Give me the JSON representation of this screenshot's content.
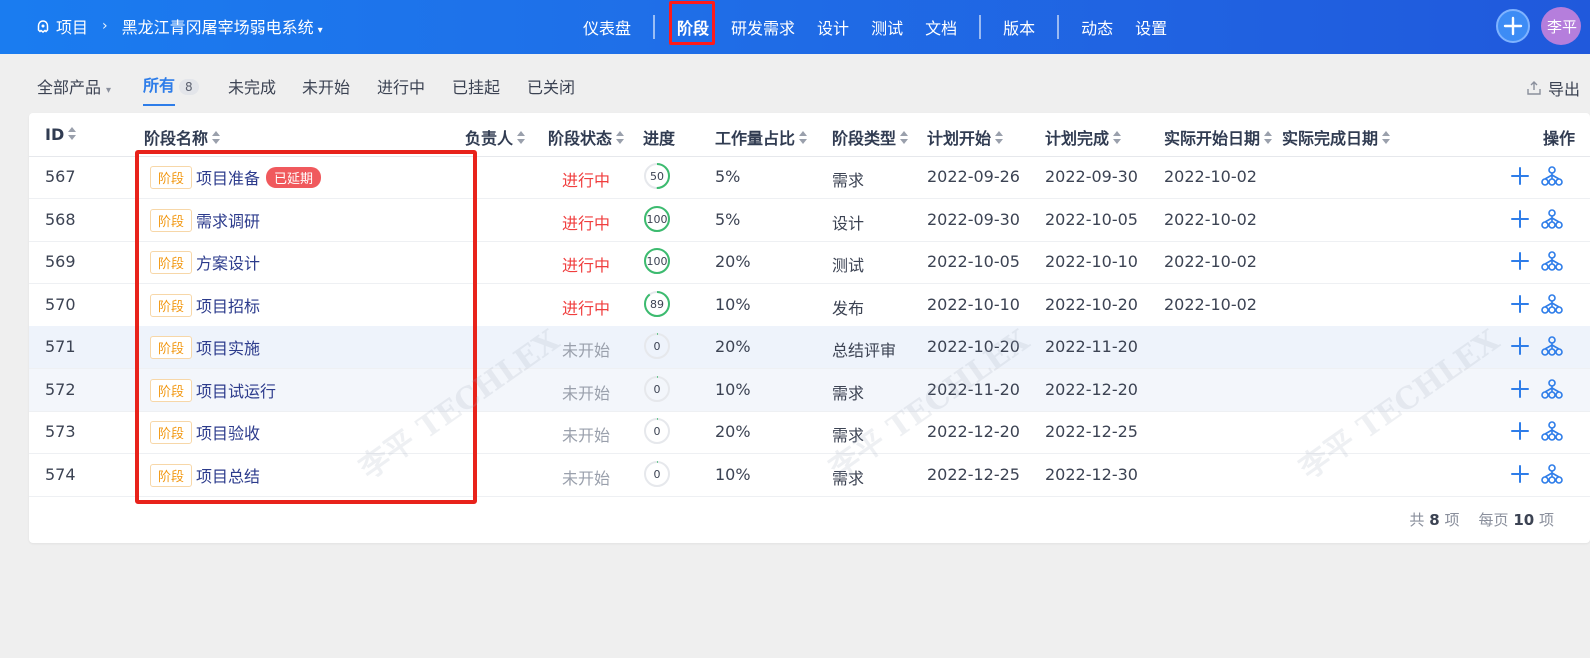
{
  "header": {
    "project_label": "项目",
    "project_name": "黑龙江青冈屠宰场弱电系统",
    "nav": [
      "仪表盘",
      "阶段",
      "研发需求",
      "设计",
      "测试",
      "文档",
      "版本",
      "动态",
      "设置"
    ],
    "active_nav": "阶段",
    "avatar_text": "李平"
  },
  "toolbar": {
    "product_filter": "全部产品",
    "tabs": [
      {
        "label": "所有",
        "count": "8"
      },
      {
        "label": "未完成"
      },
      {
        "label": "未开始"
      },
      {
        "label": "进行中"
      },
      {
        "label": "已挂起"
      },
      {
        "label": "已关闭"
      }
    ],
    "export_label": "导出"
  },
  "table": {
    "columns": [
      "ID",
      "阶段名称",
      "负责人",
      "阶段状态",
      "进度",
      "工作量占比",
      "阶段类型",
      "计划开始",
      "计划完成",
      "实际开始日期",
      "实际完成日期",
      "操作"
    ],
    "tag_label": "阶段",
    "rows": [
      {
        "id": "567",
        "name": "项目准备",
        "badge": "已延期",
        "owner": "",
        "status": "进行中",
        "progress": 50,
        "workload": "5%",
        "type": "需求",
        "plan_start": "2022-09-26",
        "plan_end": "2022-09-30",
        "real_start": "2022-10-02",
        "real_end": ""
      },
      {
        "id": "568",
        "name": "需求调研",
        "badge": "",
        "owner": "",
        "status": "进行中",
        "progress": 100,
        "workload": "5%",
        "type": "设计",
        "plan_start": "2022-09-30",
        "plan_end": "2022-10-05",
        "real_start": "2022-10-02",
        "real_end": ""
      },
      {
        "id": "569",
        "name": "方案设计",
        "badge": "",
        "owner": "",
        "status": "进行中",
        "progress": 100,
        "workload": "20%",
        "type": "测试",
        "plan_start": "2022-10-05",
        "plan_end": "2022-10-10",
        "real_start": "2022-10-02",
        "real_end": ""
      },
      {
        "id": "570",
        "name": "项目招标",
        "badge": "",
        "owner": "",
        "status": "进行中",
        "progress": 89,
        "workload": "10%",
        "type": "发布",
        "plan_start": "2022-10-10",
        "plan_end": "2022-10-20",
        "real_start": "2022-10-02",
        "real_end": ""
      },
      {
        "id": "571",
        "name": "项目实施",
        "badge": "",
        "owner": "",
        "status": "未开始",
        "progress": 0,
        "workload": "20%",
        "type": "总结评审",
        "plan_start": "2022-10-20",
        "plan_end": "2022-11-20",
        "real_start": "",
        "real_end": ""
      },
      {
        "id": "572",
        "name": "项目试运行",
        "badge": "",
        "owner": "",
        "status": "未开始",
        "progress": 0,
        "workload": "10%",
        "type": "需求",
        "plan_start": "2022-11-20",
        "plan_end": "2022-12-20",
        "real_start": "",
        "real_end": ""
      },
      {
        "id": "573",
        "name": "项目验收",
        "badge": "",
        "owner": "",
        "status": "未开始",
        "progress": 0,
        "workload": "20%",
        "type": "需求",
        "plan_start": "2022-12-20",
        "plan_end": "2022-12-25",
        "real_start": "",
        "real_end": ""
      },
      {
        "id": "574",
        "name": "项目总结",
        "badge": "",
        "owner": "",
        "status": "未开始",
        "progress": 0,
        "workload": "10%",
        "type": "需求",
        "plan_start": "2022-12-25",
        "plan_end": "2022-12-30",
        "real_start": "",
        "real_end": ""
      }
    ]
  },
  "pager": {
    "total_prefix": "共",
    "total": "8",
    "total_suffix": "项",
    "per_page_prefix": "每页",
    "per_page": "10",
    "per_page_suffix": "项"
  },
  "watermark_text": "李平 TECHLEX",
  "colors": {
    "accent": "#2e7de9",
    "header_start": "#1a7cf0",
    "header_end": "#2059dc",
    "status_doing": "#f03e3e",
    "status_waiting": "#9aa0ac",
    "progress_ring": "#3cbb6f",
    "annotation_red": "#e8221b"
  },
  "icons": {
    "project": "project-icon",
    "add": "plus-icon",
    "tree": "sitemap-icon",
    "export": "export-icon"
  }
}
